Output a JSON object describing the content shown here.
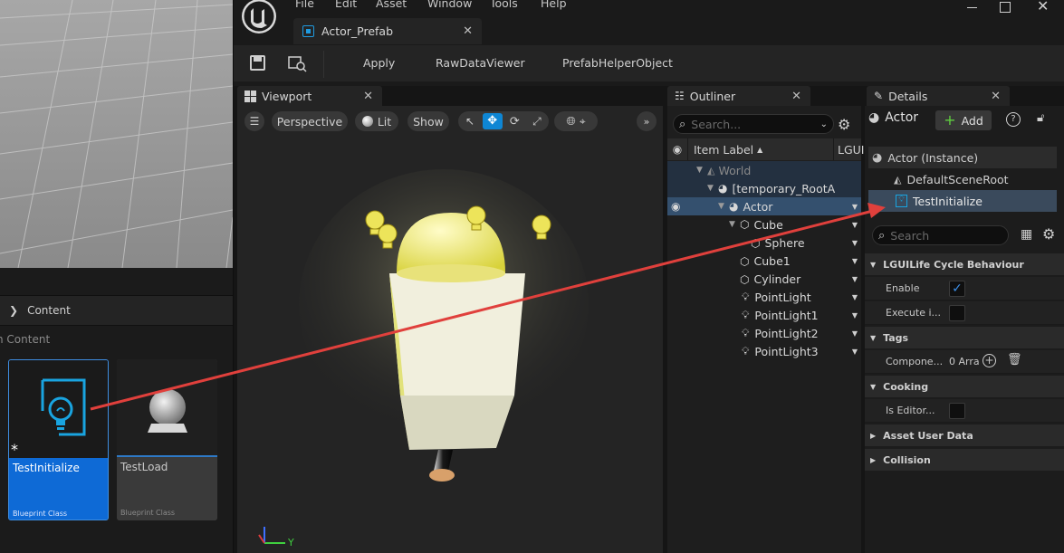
{
  "menu": [
    "File",
    "Edit",
    "Asset",
    "Window",
    "Tools",
    "Help"
  ],
  "document_tab": {
    "label": "Actor_Prefab"
  },
  "toolbar": {
    "apply": "Apply",
    "raw_data_viewer": "RawDataViewer",
    "prefab_helper": "PrefabHelperObject"
  },
  "viewport": {
    "tab_label": "Viewport",
    "perspective": "Perspective",
    "lit": "Lit",
    "show": "Show",
    "axis_y": "Y"
  },
  "content_browser": {
    "header": "Content",
    "path": "n Content",
    "assets": [
      {
        "name": "TestInitialize",
        "type": "Blueprint Class"
      },
      {
        "name": "TestLoad",
        "type": "Blueprint Class"
      }
    ]
  },
  "outliner": {
    "tab_label": "Outliner",
    "search_placeholder": "Search...",
    "col_item_label": "Item Label",
    "col_type": "LGUI",
    "rows": [
      {
        "label": "World"
      },
      {
        "label": "[temporary_RootA"
      },
      {
        "label": "Actor"
      },
      {
        "label": "Cube"
      },
      {
        "label": "Sphere"
      },
      {
        "label": "Cube1"
      },
      {
        "label": "Cylinder"
      },
      {
        "label": "PointLight"
      },
      {
        "label": "PointLight1"
      },
      {
        "label": "PointLight2"
      },
      {
        "label": "PointLight3"
      }
    ]
  },
  "details": {
    "tab_label": "Details",
    "actor_name": "Actor",
    "add_label": "Add",
    "tree": [
      "Actor (Instance)",
      "DefaultSceneRoot",
      "TestInitialize"
    ],
    "search_placeholder": "Search",
    "categories": {
      "lgui": "LGUILife Cycle Behaviour",
      "tags": "Tags",
      "cooking": "Cooking",
      "asset_user_data": "Asset User Data",
      "collision": "Collision"
    },
    "props": {
      "enable": "Enable",
      "execute": "Execute i...",
      "component_tags": "Compone...",
      "component_tags_value": "0 Arra",
      "is_editor": "Is Editor..."
    }
  },
  "colors": {
    "accent": "#0e86d4",
    "arrow": "#e0403c",
    "selected_row": "#3a4a5c"
  }
}
